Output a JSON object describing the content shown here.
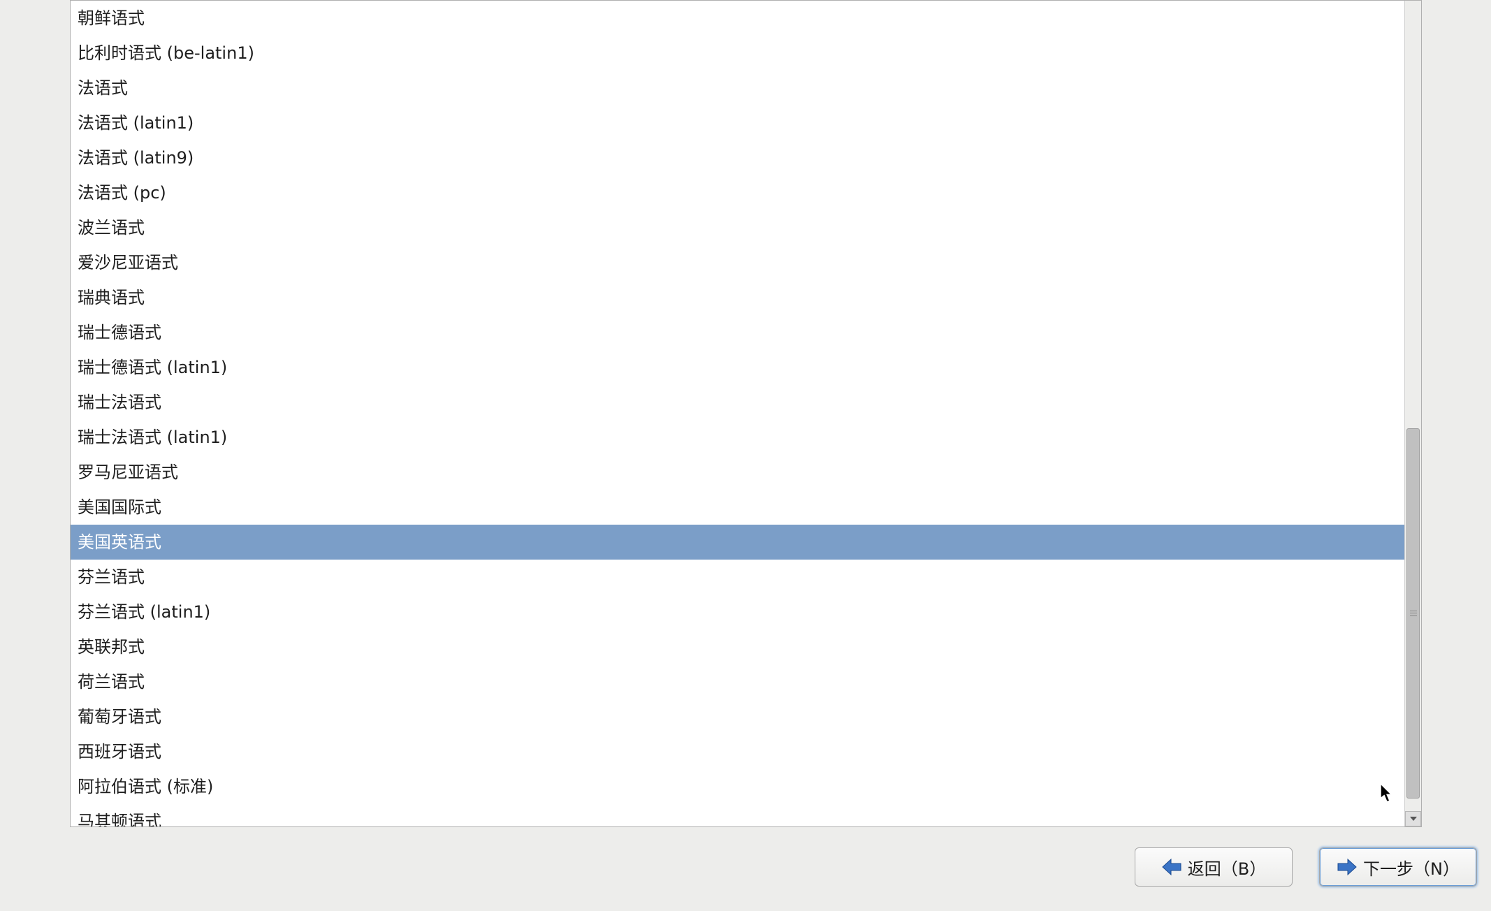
{
  "list": {
    "items": [
      {
        "label": "朝鲜语式",
        "selected": false
      },
      {
        "label": "比利时语式 (be-latin1)",
        "selected": false
      },
      {
        "label": "法语式",
        "selected": false
      },
      {
        "label": "法语式 (latin1)",
        "selected": false
      },
      {
        "label": "法语式 (latin9)",
        "selected": false
      },
      {
        "label": "法语式 (pc)",
        "selected": false
      },
      {
        "label": "波兰语式",
        "selected": false
      },
      {
        "label": "爱沙尼亚语式",
        "selected": false
      },
      {
        "label": "瑞典语式",
        "selected": false
      },
      {
        "label": "瑞士德语式",
        "selected": false
      },
      {
        "label": "瑞士德语式 (latin1)",
        "selected": false
      },
      {
        "label": "瑞士法语式",
        "selected": false
      },
      {
        "label": "瑞士法语式 (latin1)",
        "selected": false
      },
      {
        "label": "罗马尼亚语式",
        "selected": false
      },
      {
        "label": "美国国际式",
        "selected": false
      },
      {
        "label": "美国英语式",
        "selected": true
      },
      {
        "label": "芬兰语式",
        "selected": false
      },
      {
        "label": "芬兰语式 (latin1)",
        "selected": false
      },
      {
        "label": "英联邦式",
        "selected": false
      },
      {
        "label": "荷兰语式",
        "selected": false
      },
      {
        "label": "葡萄牙语式",
        "selected": false
      },
      {
        "label": "西班牙语式",
        "selected": false
      },
      {
        "label": "阿拉伯语式 (标准)",
        "selected": false
      },
      {
        "label": "马其顿语式",
        "selected": false
      }
    ]
  },
  "buttons": {
    "back_label": "返回（B）",
    "next_label": "下一步（N）"
  }
}
